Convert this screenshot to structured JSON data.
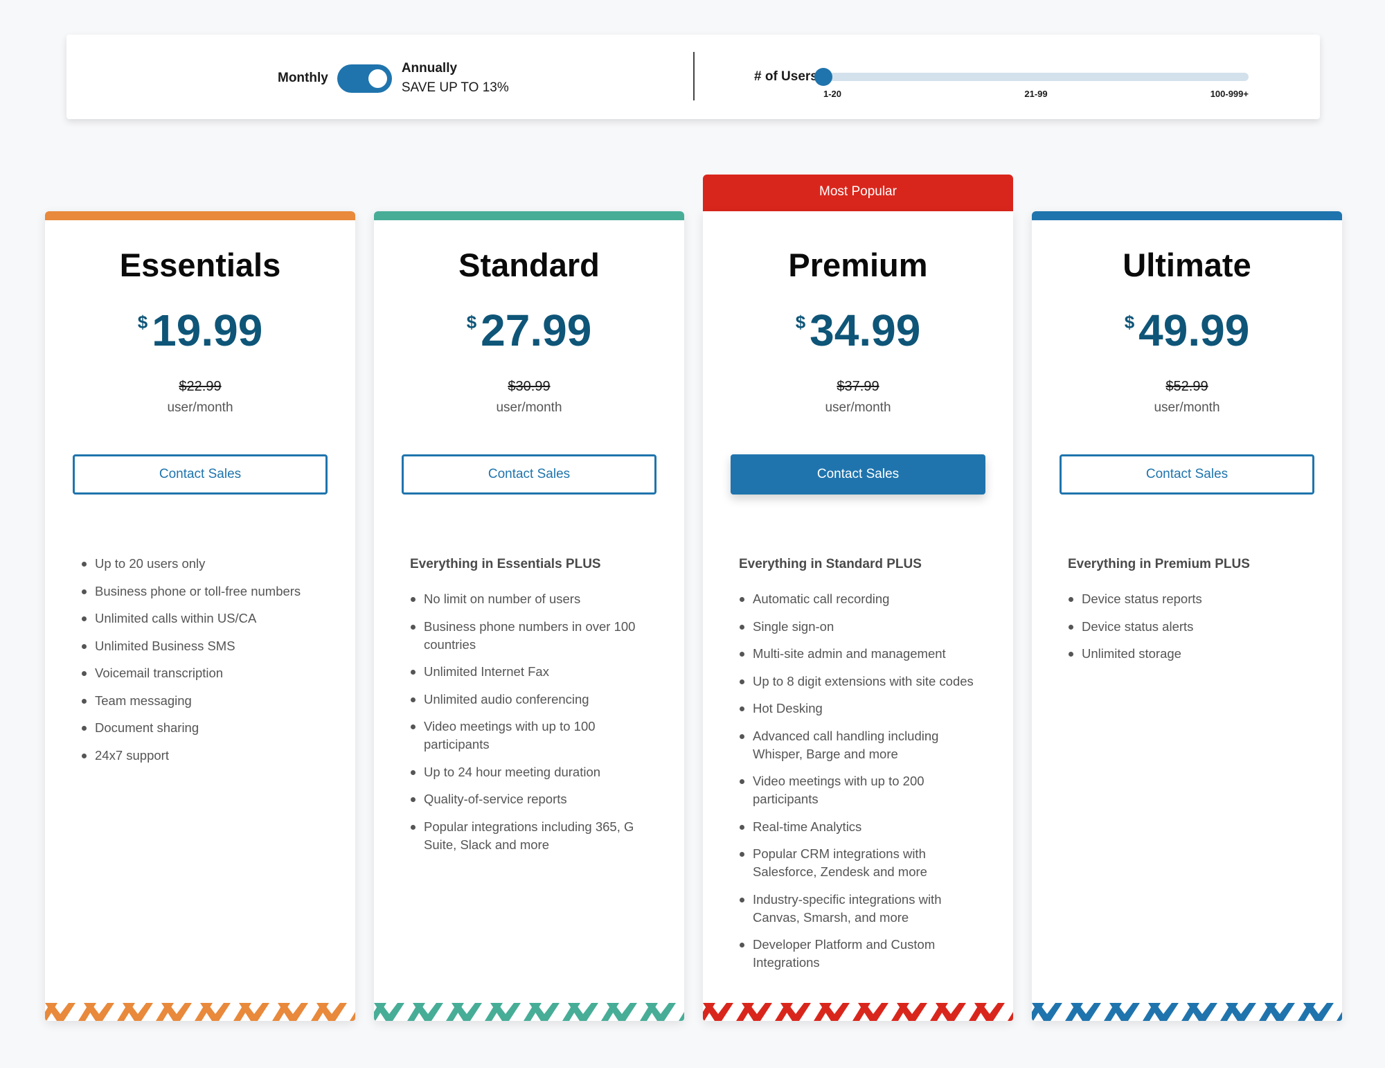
{
  "billing": {
    "monthly_label": "Monthly",
    "annual_label": "Annually",
    "save_label": "SAVE UP TO 13%",
    "annual_selected": true
  },
  "users": {
    "label": "# of Users",
    "ticks": [
      "1-20",
      "21-99",
      "100-999+"
    ],
    "selected_index": 0,
    "selected_value": "1-20"
  },
  "colors": {
    "accent_blue": "#1f74ad",
    "price_blue": "#0e5578",
    "popular_red": "#d9261c",
    "essentials": "#e8893b",
    "standard": "#47ad97",
    "premium": "#d9261c",
    "ultimate": "#1f74ad"
  },
  "plans": [
    {
      "name": "Essentials",
      "currency": "$",
      "price": "19.99",
      "original_price": "$22.99",
      "unit": "user/month",
      "cta": "Contact Sales",
      "color": "#e8893b",
      "features_header": "",
      "features": [
        "Up to 20 users only",
        "Business phone or toll-free numbers",
        "Unlimited calls within US/CA",
        "Unlimited Business SMS",
        "Voicemail transcription",
        "Team messaging",
        "Document sharing",
        "24x7 support"
      ]
    },
    {
      "name": "Standard",
      "currency": "$",
      "price": "27.99",
      "original_price": "$30.99",
      "unit": "user/month",
      "cta": "Contact Sales",
      "color": "#47ad97",
      "features_header": "Everything in Essentials PLUS",
      "features": [
        "No limit on number of users",
        "Business phone numbers in over 100 countries",
        "Unlimited Internet Fax",
        "Unlimited audio conferencing",
        "Video meetings with up to 100 participants",
        "Up to 24 hour meeting duration",
        "Quality-of-service reports",
        "Popular integrations including 365, G Suite, Slack and more"
      ]
    },
    {
      "name": "Premium",
      "badge": "Most Popular",
      "currency": "$",
      "price": "34.99",
      "original_price": "$37.99",
      "unit": "user/month",
      "cta": "Contact Sales",
      "color": "#d9261c",
      "features_header": "Everything in Standard PLUS",
      "features": [
        "Automatic call recording",
        "Single sign-on",
        "Multi-site admin and management",
        "Up to 8 digit extensions with site codes",
        "Hot Desking",
        "Advanced call handling including Whisper, Barge and more",
        "Video meetings with up to 200 participants",
        "Real-time Analytics",
        "Popular CRM integrations with Salesforce, Zendesk and more",
        "Industry-specific integrations with Canvas, Smarsh, and more",
        "Developer Platform and Custom Integrations"
      ]
    },
    {
      "name": "Ultimate",
      "currency": "$",
      "price": "49.99",
      "original_price": "$52.99",
      "unit": "user/month",
      "cta": "Contact Sales",
      "color": "#1f74ad",
      "features_header": "Everything in Premium PLUS",
      "features": [
        "Device status reports",
        "Device status alerts",
        "Unlimited storage"
      ]
    }
  ]
}
